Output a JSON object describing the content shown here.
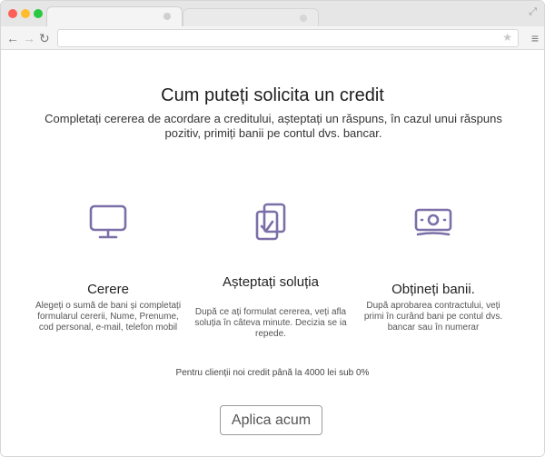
{
  "main": {
    "title": "Cum puteți solicita un credit",
    "subtitle": "Completați cererea de acordare a creditului, așteptați un răspuns, în cazul unui răspuns pozitiv, primiți banii pe contul dvs. bancar.",
    "steps": [
      {
        "icon": "monitor-icon",
        "title": "Cerere",
        "description": "Alegeți o sumă de bani și completați formularul cererii, Nume, Prenume, cod personal, e-mail, telefon mobil"
      },
      {
        "icon": "clipboard-check-icon",
        "title": "Așteptați soluția",
        "description": "După ce ați formulat cererea, veți afla soluția în câteva minute. Decizia se ia repede."
      },
      {
        "icon": "banknote-icon",
        "title": "Obțineți banii.",
        "description": "După aprobarea contractului, veți primi în curând bani pe contul dvs. bancar sau în numerar"
      }
    ],
    "promo": "Pentru clienții noi credit până la 4000 lei sub 0%",
    "apply_label": "Aplica acum"
  },
  "colors": {
    "accent": "#7b6fa8"
  }
}
